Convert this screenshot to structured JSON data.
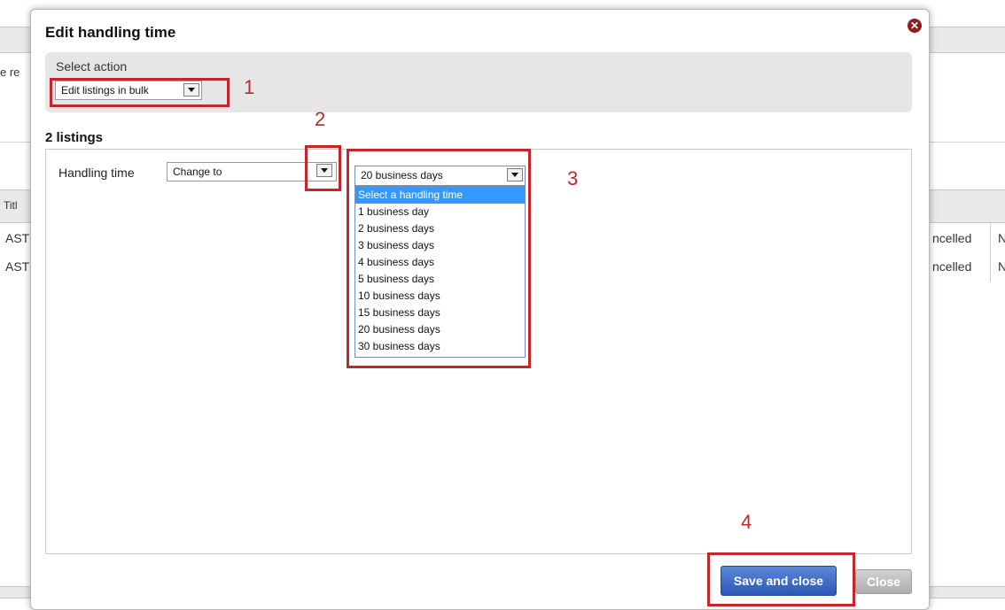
{
  "background": {
    "partial_text": "e re",
    "column_header": "Titl",
    "rows": [
      {
        "left": "AST",
        "status": "ncelled",
        "extra": "N"
      },
      {
        "left": "AST",
        "status": "ncelled",
        "extra": "N"
      }
    ]
  },
  "modal": {
    "title": "Edit handling time",
    "select_action": {
      "label": "Select action",
      "value": "Edit listings in bulk"
    },
    "listings_title": "2 listings",
    "handling_time": {
      "label": "Handling time",
      "mode_value": "Change to",
      "days_value": "20 business days",
      "options": [
        "Select a handling time",
        "1 business day",
        "2 business days",
        "3 business days",
        "4 business days",
        "5 business days",
        "10 business days",
        "15 business days",
        "20 business days",
        "30 business days"
      ],
      "highlighted_option_index": 0
    },
    "buttons": {
      "save": "Save and close",
      "close": "Close"
    }
  },
  "annotations": {
    "step1": "1",
    "step2": "2",
    "step3": "3",
    "step4": "4",
    "color": "#c4262b"
  },
  "colors": {
    "primary_button": "#2c59b7",
    "highlight": "#3399ff",
    "close_icon": "#8b1d1d"
  }
}
